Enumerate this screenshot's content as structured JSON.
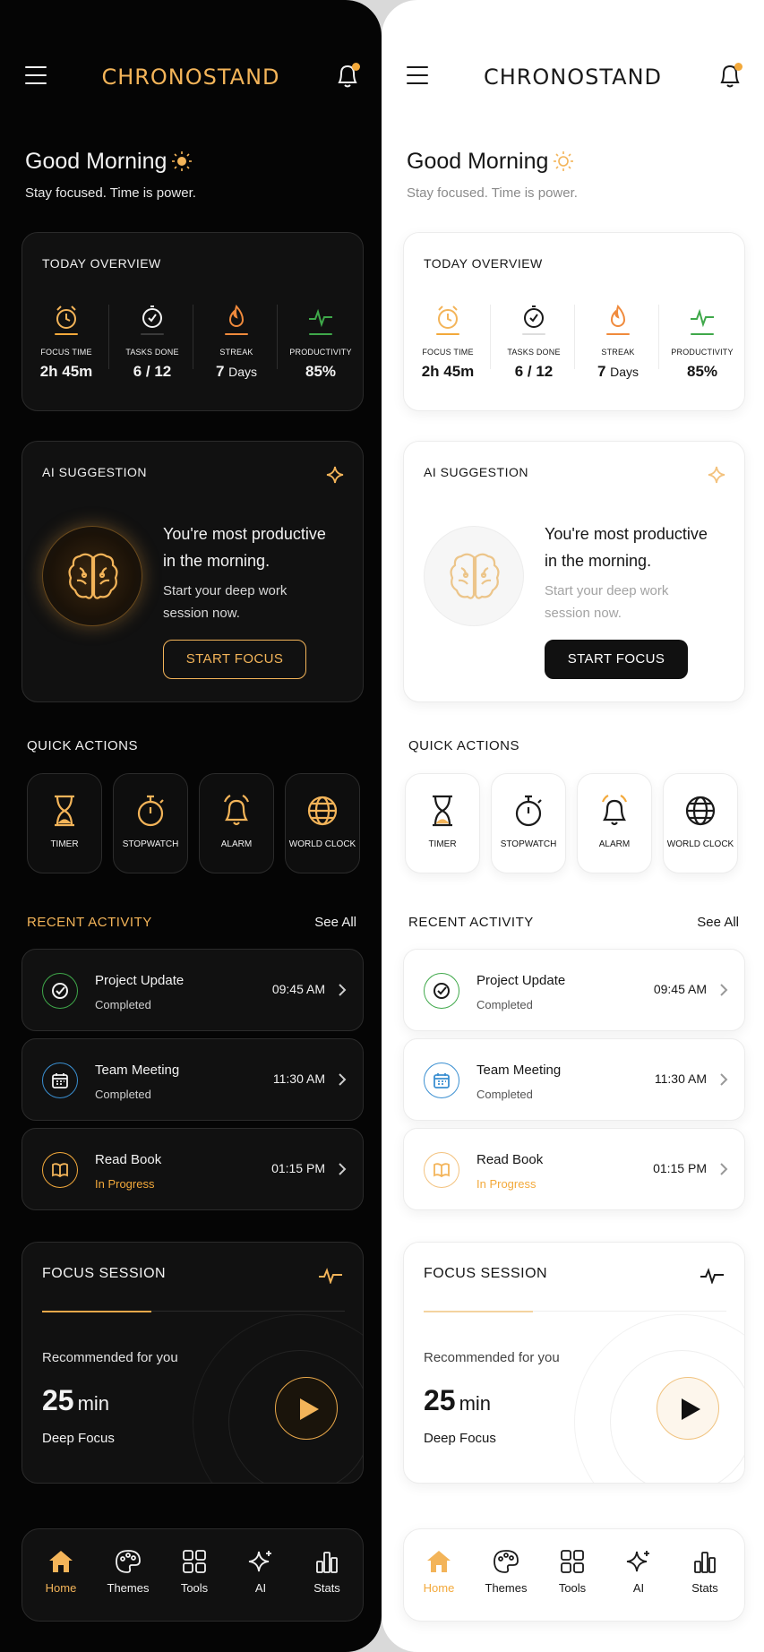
{
  "app_title": "CHRONOSTAND",
  "greeting": "Good Morning",
  "subtitle": "Stay focused. Time is power.",
  "overview": {
    "title": "TODAY OVERVIEW",
    "stats": [
      {
        "label": "FOCUS TIME",
        "value": "2h 45m",
        "icon": "alarm-clock-icon"
      },
      {
        "label": "TASKS DONE",
        "value": "6 / 12",
        "icon": "check-clock-icon"
      },
      {
        "label": "STREAK",
        "value": "7",
        "unit": "Days",
        "icon": "flame-icon"
      },
      {
        "label": "PRODUCTIVITY",
        "value": "85%",
        "icon": "pulse-icon"
      }
    ]
  },
  "ai": {
    "title": "AI SUGGESTION",
    "headline": "You're most productive in the morning.",
    "body": "Start your deep work session now.",
    "button": "START FOCUS"
  },
  "quick_actions": {
    "title": "QUICK ACTIONS",
    "items": [
      {
        "label": "TIMER",
        "icon": "hourglass-icon"
      },
      {
        "label": "STOPWATCH",
        "icon": "stopwatch-icon"
      },
      {
        "label": "ALARM",
        "icon": "alarm-bell-icon"
      },
      {
        "label": "WORLD CLOCK",
        "icon": "globe-icon"
      }
    ]
  },
  "recent": {
    "title": "RECENT ACTIVITY",
    "see_all": "See All",
    "items": [
      {
        "name": "Project Update",
        "status": "Completed",
        "time": "09:45 AM",
        "icon": "check-circle-icon"
      },
      {
        "name": "Team Meeting",
        "status": "Completed",
        "time": "11:30 AM",
        "icon": "calendar-icon"
      },
      {
        "name": "Read Book",
        "status": "In Progress",
        "time": "01:15 PM",
        "icon": "book-icon"
      }
    ]
  },
  "focus_session": {
    "title": "FOCUS SESSION",
    "recommended": "Recommended for you",
    "minutes": "25",
    "unit": "min",
    "type": "Deep Focus"
  },
  "nav": {
    "items": [
      {
        "label": "Home",
        "icon": "home-icon",
        "active": true
      },
      {
        "label": "Themes",
        "icon": "palette-icon"
      },
      {
        "label": "Tools",
        "icon": "grid-icon"
      },
      {
        "label": "AI",
        "icon": "sparkle-icon"
      },
      {
        "label": "Stats",
        "icon": "bar-chart-icon"
      }
    ]
  },
  "themes": {
    "dark": {
      "bg": "#050505",
      "card": "#111111",
      "accent": "#f3b459",
      "text": "#f2f2f2"
    },
    "light": {
      "bg": "#ffffff",
      "card": "#ffffff",
      "accent": "#f3a93b",
      "text": "#161616"
    }
  },
  "colors": {
    "orange": "#f3a93b",
    "green": "#3fa84a",
    "blue": "#3a8fd1",
    "amber_text": "#e9a84a"
  }
}
